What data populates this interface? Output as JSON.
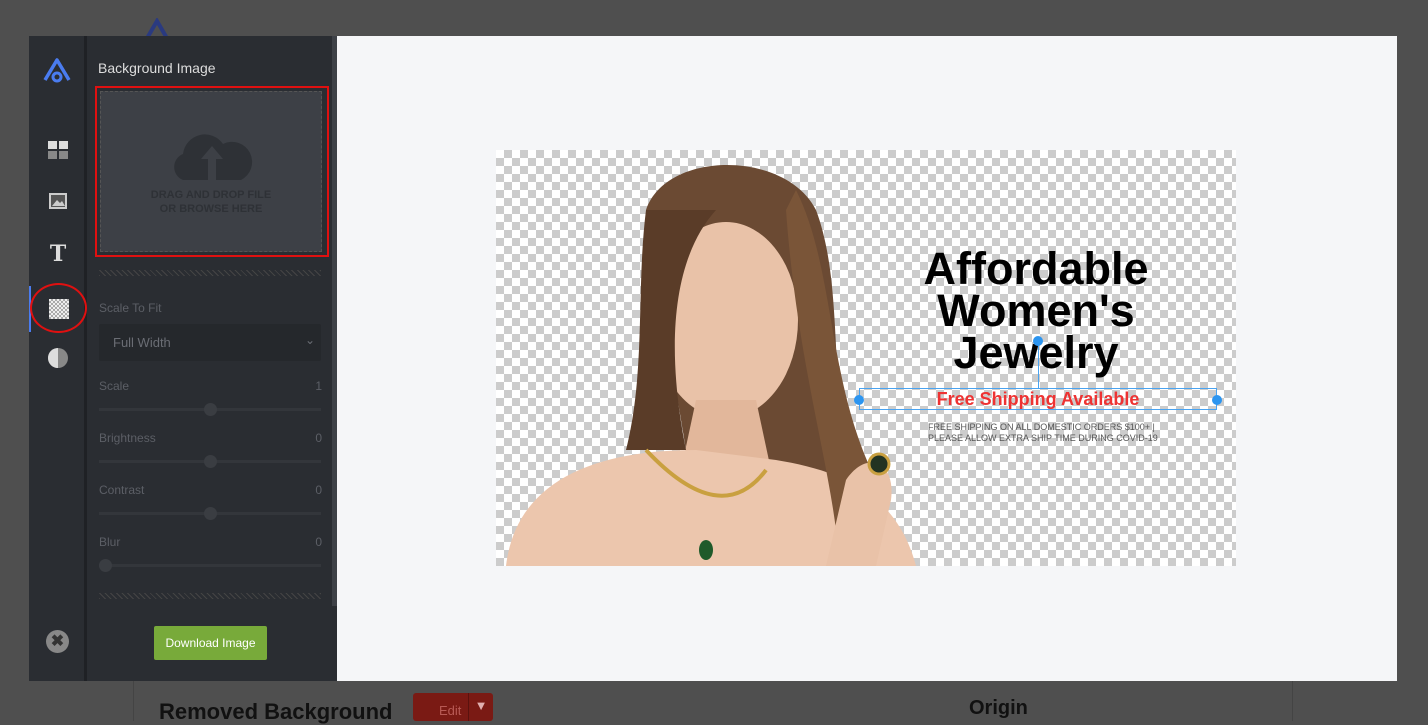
{
  "background_page": {
    "section_title": "Removed Background",
    "edit_label": "Edit",
    "origin_title": "Origin"
  },
  "rail": {
    "items": [
      {
        "icon": "layout-grid-icon"
      },
      {
        "icon": "image-icon"
      },
      {
        "icon": "text-icon"
      },
      {
        "icon": "transparency-checker-icon",
        "active": true
      },
      {
        "icon": "contrast-icon"
      }
    ],
    "close_icon": "close-icon"
  },
  "panel": {
    "title": "Background Image",
    "dropzone": {
      "line1": "DRAG AND DROP FILE",
      "line2": "OR BROWSE HERE"
    },
    "scale_to_fit_label": "Scale To Fit",
    "scale_to_fit_value": "Full Width",
    "sliders": [
      {
        "label": "Scale",
        "value": "1",
        "fraction": 0.5
      },
      {
        "label": "Brightness",
        "value": "0",
        "fraction": 0.5
      },
      {
        "label": "Contrast",
        "value": "0",
        "fraction": 0.5
      },
      {
        "label": "Blur",
        "value": "0",
        "fraction": 0
      }
    ],
    "download_label": "Download Image"
  },
  "canvas": {
    "headline": [
      "Affordable",
      "Women's",
      "Jewelry"
    ],
    "subheadline": "Free Shipping Available",
    "fine_print": [
      "FREE SHIPPING ON ALL DOMESTIC ORDERS $100+  |",
      "PLEASE ALLOW EXTRA SHIP TIME DURING COVID-19"
    ],
    "colors": {
      "subheadline": "#ee3333",
      "selection": "#2c95f0",
      "download_button": "#78aa3a",
      "accent": "#4a7cf0"
    }
  }
}
